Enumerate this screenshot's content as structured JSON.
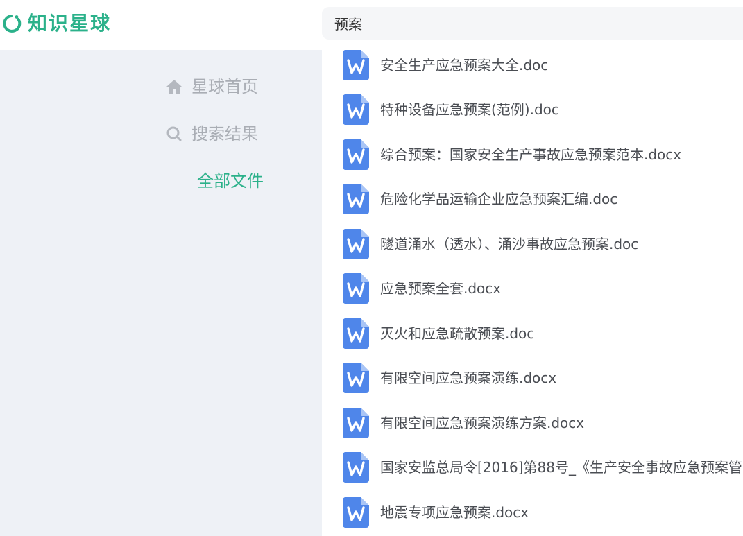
{
  "app": {
    "logo_text": "知识星球",
    "brand_color": "#2bb18a",
    "icon_color": "#4f86ea"
  },
  "search": {
    "value": "预案"
  },
  "sidebar": {
    "items": [
      {
        "label": "星球首页",
        "icon": "home-icon",
        "active": false
      },
      {
        "label": "搜索结果",
        "icon": "search-icon",
        "active": false
      },
      {
        "label": "全部文件",
        "icon": "",
        "active": true
      }
    ]
  },
  "files": [
    {
      "name": "安全生产应急预案大全.doc",
      "icon": "word-file-icon"
    },
    {
      "name": "特种设备应急预案(范例).doc",
      "icon": "word-file-icon"
    },
    {
      "name": "综合预案：国家安全生产事故应急预案范本.docx",
      "icon": "word-file-icon"
    },
    {
      "name": "危险化学品运输企业应急预案汇编.doc",
      "icon": "word-file-icon"
    },
    {
      "name": "隧道涌水（透水）、涌沙事故应急预案.doc",
      "icon": "word-file-icon"
    },
    {
      "name": "应急预案全套.docx",
      "icon": "word-file-icon"
    },
    {
      "name": "灭火和应急疏散预案.doc",
      "icon": "word-file-icon"
    },
    {
      "name": "有限空间应急预案演练.docx",
      "icon": "word-file-icon"
    },
    {
      "name": "有限空间应急预案演练方案.docx",
      "icon": "word-file-icon"
    },
    {
      "name": "国家安监总局令[2016]第88号_《生产安全事故应急预案管",
      "icon": "word-file-icon"
    },
    {
      "name": "地震专项应急预案.docx",
      "icon": "word-file-icon"
    }
  ]
}
